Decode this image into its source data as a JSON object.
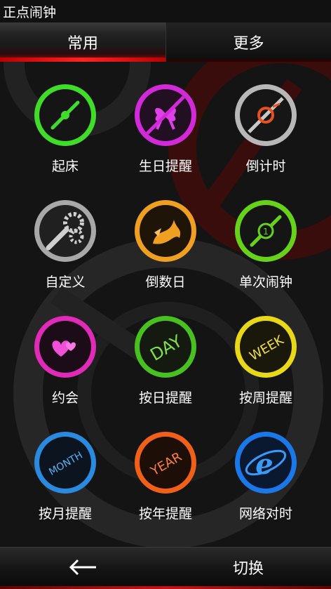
{
  "app": {
    "title": "正点闹钟"
  },
  "tabs": [
    {
      "label": "常用",
      "active": true
    },
    {
      "label": "更多",
      "active": false
    }
  ],
  "items": [
    {
      "label": "起床",
      "icon": "wake-up-clock-icon",
      "color": "#3fdc2a"
    },
    {
      "label": "生日提醒",
      "icon": "birthday-gift-icon",
      "color": "#d22ad8"
    },
    {
      "label": "倒计时",
      "icon": "countdown-icon",
      "color": "#b8b8b8"
    },
    {
      "label": "自定义",
      "icon": "custom-gears-icon",
      "color": "#a8a8a8"
    },
    {
      "label": "倒数日",
      "icon": "countdown-days-icon",
      "color": "#f0a020"
    },
    {
      "label": "单次闹钟",
      "icon": "single-alarm-icon",
      "color": "#66d21a"
    },
    {
      "label": "约会",
      "icon": "date-hearts-icon",
      "color": "#e02ab8"
    },
    {
      "label": "按日提醒",
      "icon": "daily-reminder-icon",
      "color": "#48c020",
      "text": "DAY"
    },
    {
      "label": "按周提醒",
      "icon": "weekly-reminder-icon",
      "color": "#e8d818",
      "text": "WEEK"
    },
    {
      "label": "按月提醒",
      "icon": "monthly-reminder-icon",
      "color": "#2a8ae0",
      "text": "MONTH"
    },
    {
      "label": "按年提醒",
      "icon": "yearly-reminder-icon",
      "color": "#f06018",
      "text": "YEAR"
    },
    {
      "label": "网络对时",
      "icon": "network-time-icon",
      "color": "#1a78e8"
    }
  ],
  "bottom": {
    "back_icon": "back-arrow-icon",
    "switch_label": "切换"
  }
}
